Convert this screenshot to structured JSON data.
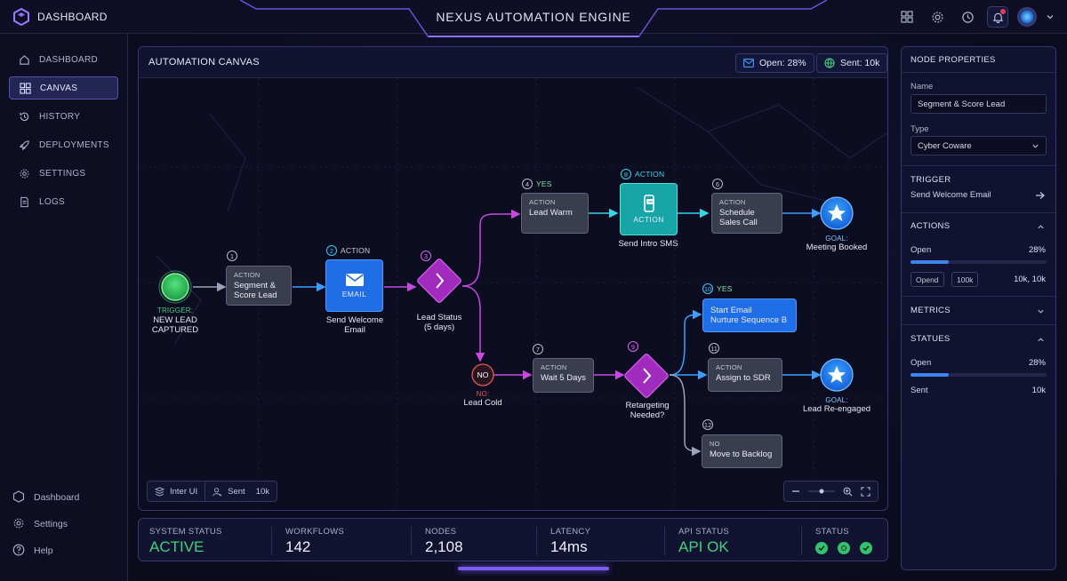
{
  "app": {
    "brand": "DASHBOARD",
    "title": "NEXUS AUTOMATION ENGINE",
    "notification_count": "3"
  },
  "sidebar": {
    "items": [
      {
        "label": "DASHBOARD",
        "icon": "home-icon"
      },
      {
        "label": "CANVAS",
        "icon": "grid-icon",
        "active": true
      },
      {
        "label": "HISTORY",
        "icon": "history-icon"
      },
      {
        "label": "DEPLOYMENTS",
        "icon": "rocket-icon"
      },
      {
        "label": "SETTINGS",
        "icon": "gear-icon"
      },
      {
        "label": "LOGS",
        "icon": "document-icon"
      }
    ],
    "footer": [
      {
        "label": "Dashboard",
        "icon": "cube-icon"
      },
      {
        "label": "Settings",
        "icon": "gear-icon"
      },
      {
        "label": "Help",
        "icon": "help-icon"
      }
    ]
  },
  "canvas": {
    "title": "AUTOMATION CANVAS",
    "open_pill": "Open: 28%",
    "sent_pill": "Sent: 10k",
    "footer_left": {
      "ui_label": "Inter UI",
      "sent_label": "Sent",
      "sent_value": "10k"
    }
  },
  "flow": {
    "trigger": {
      "tag": "TRIGGER:",
      "label1": "NEW LEAD",
      "label2": "CAPTURED"
    },
    "n1": {
      "num": "1",
      "tag": "ACTION",
      "line1": "Segment &",
      "line2": "Score Lead"
    },
    "n2": {
      "num": "2",
      "label": "ACTION",
      "icon_text": "EMAIL",
      "caption1": "Send Welcome",
      "caption2": "Email"
    },
    "n3": {
      "num": "3",
      "caption1": "Lead Status",
      "caption2": "(5 days)"
    },
    "n4": {
      "num": "4",
      "label": "YES",
      "tag": "ACTION",
      "line1": "Lead Warm"
    },
    "n8": {
      "num": "8",
      "label": "ACTION",
      "icon_text": "ACTION",
      "caption": "Send Intro SMS"
    },
    "n6": {
      "num": "6",
      "tag": "ACTION",
      "line1": "Schedule",
      "line2": "Sales Call"
    },
    "goal1": {
      "tag": "GOAL:",
      "label": "Meeting Booked"
    },
    "no_node": {
      "text": "NO",
      "tag": "NO:",
      "label": "Lead Cold"
    },
    "n7": {
      "num": "7",
      "tag": "ACTION",
      "line1": "Wait 5 Days"
    },
    "n9": {
      "num": "9",
      "caption1": "Retargeting",
      "caption2": "Needed?"
    },
    "n10": {
      "num": "10",
      "label": "YES",
      "line1": "Start Email",
      "line2": "Nurture Sequence B"
    },
    "n11": {
      "num": "11",
      "tag": "ACTION",
      "line1": "Assign to SDR"
    },
    "goal2": {
      "tag": "GOAL:",
      "label": "Lead Re-engaged"
    },
    "n12": {
      "num": "12",
      "tag": "NO",
      "line1": "Move to Backlog"
    }
  },
  "status": {
    "system": {
      "label": "SYSTEM STATUS",
      "value": "ACTIVE"
    },
    "workflows": {
      "label": "WORKFLOWS",
      "value": "142"
    },
    "nodes": {
      "label": "NODES",
      "value": "2,108"
    },
    "latency": {
      "label": "LATENCY",
      "value": "14ms"
    },
    "api": {
      "label": "API STATUS",
      "value": "API OK"
    },
    "status": {
      "label": "STATUS"
    }
  },
  "props": {
    "title": "NODE PROPERTIES",
    "name_label": "Name",
    "name_value": "Segment & Score Lead",
    "type_label": "Type",
    "type_value": "Cyber Coware",
    "trigger_label": "TRIGGER",
    "trigger_value": "Send Welcome Email",
    "actions_label": "ACTIONS",
    "actions_open_label": "Open",
    "actions_open_value": "28%",
    "actions_open_fraction": 0.28,
    "chip1": "Opend",
    "chip2": "100k",
    "chips_value": "10k, 10k",
    "metrics_label": "METRICS",
    "statues_label": "STATUES",
    "statues_open_label": "Open",
    "statues_open_value": "28%",
    "statues_open_fraction": 0.28,
    "statues_sent_label": "Sent",
    "statues_sent_value": "10k"
  },
  "colors": {
    "accent": "#7b5cf0",
    "blue": "#1f6ee8",
    "magenta": "#c23fd0",
    "green": "#3fd07f",
    "cyan": "#39c7ff"
  }
}
